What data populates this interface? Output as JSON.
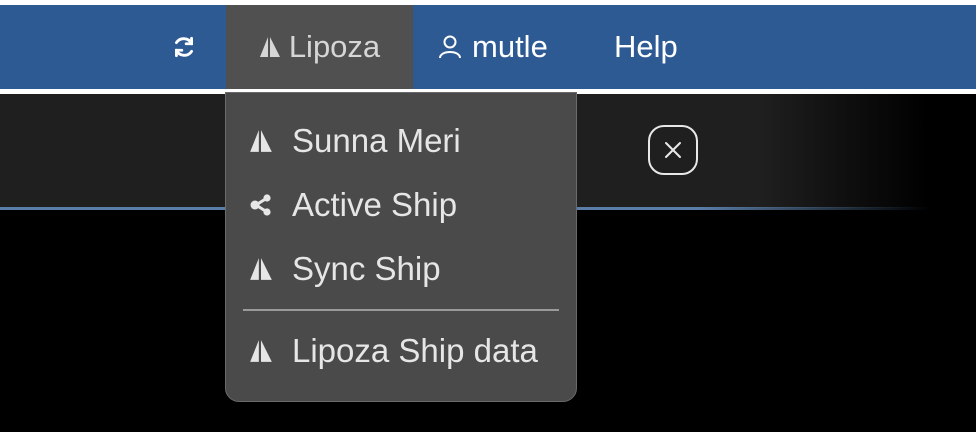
{
  "topbar": {
    "refresh_icon": "refresh-icon",
    "ship_menu": {
      "label": "Lipoza",
      "icon": "ship-icon"
    },
    "user": {
      "label": "mutle",
      "icon": "user-icon"
    },
    "help_label": "Help"
  },
  "panel": {
    "close_icon": "close-icon"
  },
  "dropdown": {
    "items": [
      {
        "label": "Sunna Meri",
        "icon": "ship-icon"
      },
      {
        "label": "Active Ship",
        "icon": "share-icon"
      },
      {
        "label": "Sync Ship",
        "icon": "ship-icon"
      },
      {
        "label": "Lipoza Ship data",
        "icon": "ship-icon"
      }
    ]
  },
  "colors": {
    "topbar": "#2e5a94",
    "active_menu": "#505050",
    "dropdown": "#4a4a4a",
    "accent_line": "#5a7ea8"
  }
}
